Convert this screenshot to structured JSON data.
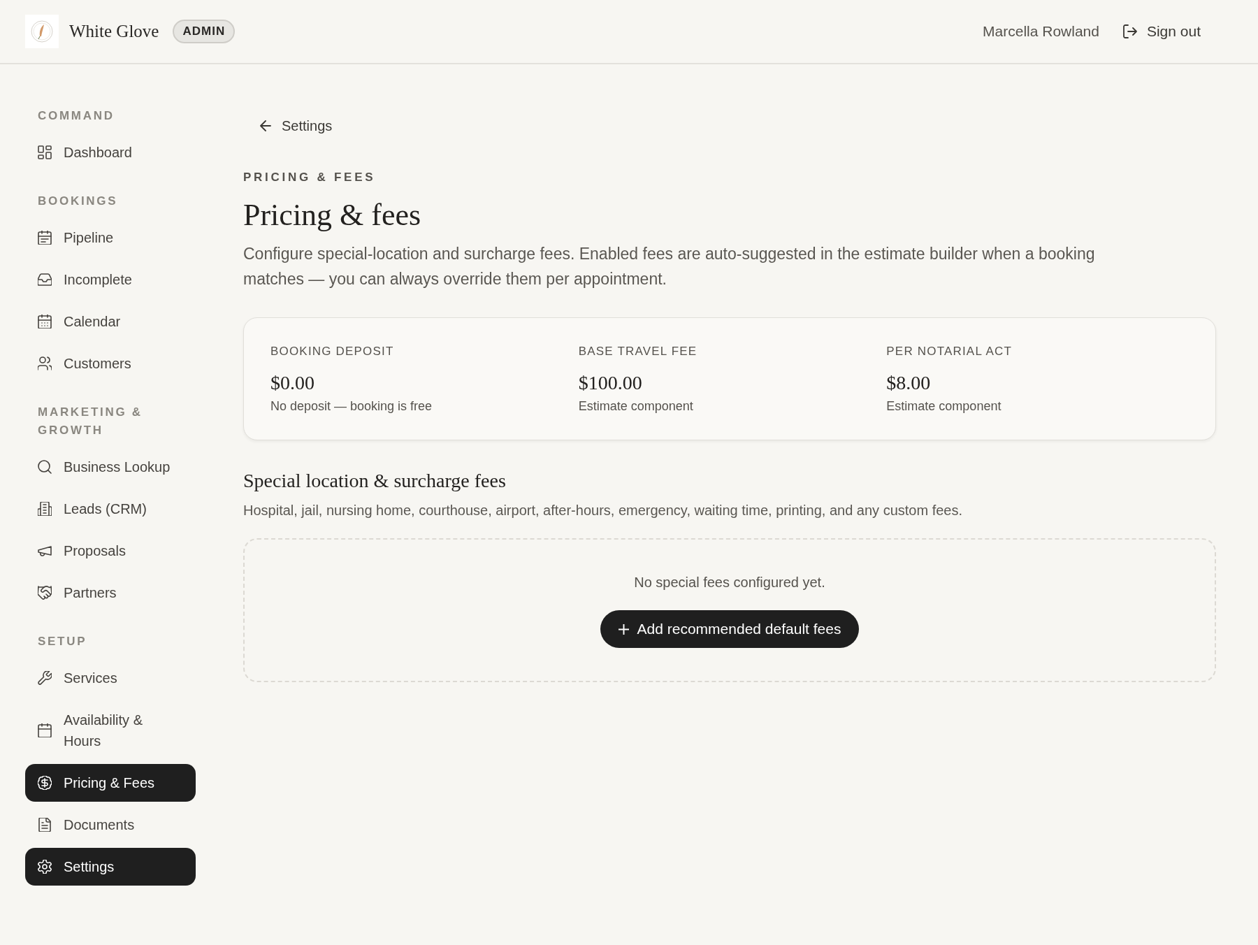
{
  "header": {
    "brand": "White Glove",
    "badge": "ADMIN",
    "user": "Marcella Rowland",
    "sign_out": "Sign out"
  },
  "sidebar": {
    "sections": [
      {
        "title": "COMMAND",
        "items": [
          {
            "label": "Dashboard",
            "selected": false
          }
        ]
      },
      {
        "title": "BOOKINGS",
        "items": [
          {
            "label": "Pipeline",
            "selected": false
          },
          {
            "label": "Incomplete",
            "selected": false
          },
          {
            "label": "Calendar",
            "selected": false
          },
          {
            "label": "Customers",
            "selected": false
          }
        ]
      },
      {
        "title": "MARKETING & GROWTH",
        "items": [
          {
            "label": "Business Lookup",
            "selected": false
          },
          {
            "label": "Leads (CRM)",
            "selected": false
          },
          {
            "label": "Proposals",
            "selected": false
          },
          {
            "label": "Partners",
            "selected": false
          }
        ]
      },
      {
        "title": "SETUP",
        "items": [
          {
            "label": "Services",
            "selected": false
          },
          {
            "label": "Availability & Hours",
            "selected": false
          },
          {
            "label": "Pricing & Fees",
            "selected": true
          },
          {
            "label": "Documents",
            "selected": false
          },
          {
            "label": "Settings",
            "selected": true
          }
        ]
      }
    ]
  },
  "main": {
    "back_link": "Settings",
    "eyebrow": "PRICING & FEES",
    "title": "Pricing & fees",
    "description": "Configure special-location and surcharge fees. Enabled fees are auto-suggested in the estimate builder when a booking matches — you can always override them per appointment.",
    "stats": [
      {
        "label": "BOOKING DEPOSIT",
        "value": "$0.00",
        "note": "No deposit — booking is free"
      },
      {
        "label": "BASE TRAVEL FEE",
        "value": "$100.00",
        "note": "Estimate component"
      },
      {
        "label": "PER NOTARIAL ACT",
        "value": "$8.00",
        "note": "Estimate component"
      }
    ],
    "special_fees": {
      "title": "Special location & surcharge fees",
      "description": "Hospital, jail, nursing home, courthouse, airport, after-hours, emergency, waiting time, printing, and any custom fees.",
      "empty_message": "No special fees configured yet.",
      "add_button": "Add recommended default fees"
    }
  }
}
